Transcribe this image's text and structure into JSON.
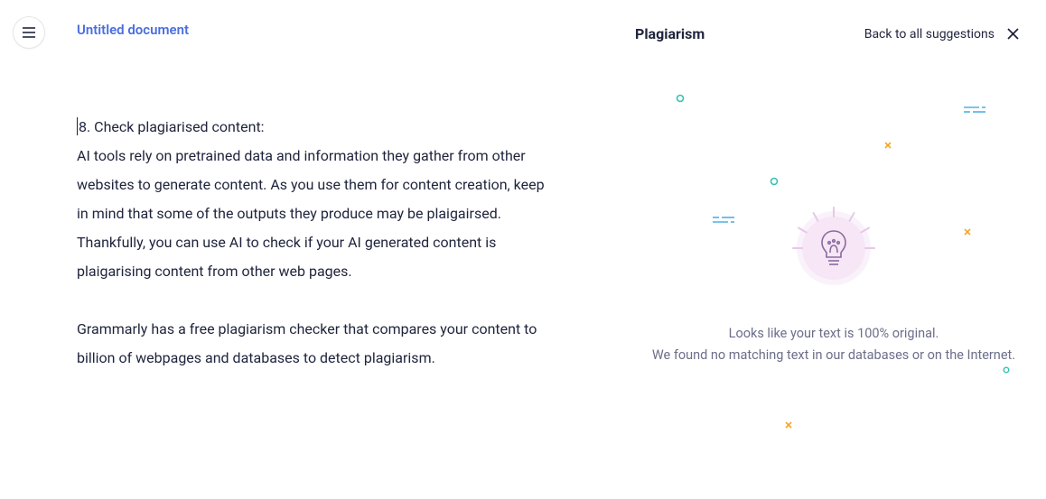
{
  "document": {
    "title": "Untitled document",
    "p1_first": "8. Check plagiarised content:",
    "p1_rest": "AI tools rely on pretrained data and information they gather from other websites to generate content. As you use them for content creation, keep in mind that some of the outputs they produce may be plaigairsed. Thankfully, you can use AI to check if your AI generated content is plaigarising content from other web pages.",
    "p2": "Grammarly has a free plagiarism checker that compares your content to billion of webpages and databases to detect plagiarism."
  },
  "panel": {
    "title": "Plagiarism",
    "back_label": "Back to all suggestions",
    "result_line1": "Looks like your text is 100% original.",
    "result_line2": "We found no matching text in our databases or on the Internet."
  },
  "colors": {
    "teal": "#34c2b3",
    "orange": "#f5a623",
    "blue": "#4fb1e8"
  }
}
